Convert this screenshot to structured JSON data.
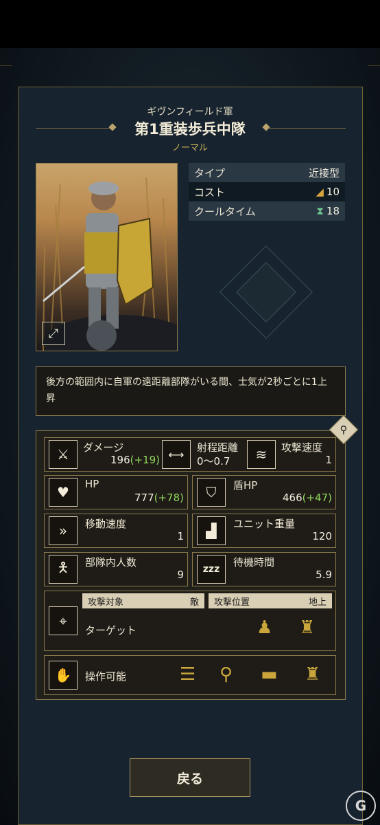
{
  "header": {
    "faction": "ギヴンフィールド軍",
    "unit_name": "第1重装歩兵中隊",
    "rarity": "ノーマル"
  },
  "info": [
    {
      "label": "タイプ",
      "value": "近接型",
      "icon": ""
    },
    {
      "label": "コスト",
      "value": "10",
      "icon": "bread-icon"
    },
    {
      "label": "クールタイム",
      "value": "18",
      "icon": "hourglass-icon"
    }
  ],
  "description": "後方の範囲内に自軍の遠距離部隊がいる間、士気が2秒ごとに1上昇",
  "stats": {
    "damage": {
      "label": "ダメージ",
      "value": "196",
      "bonus": "(+19)"
    },
    "range": {
      "label": "射程距離",
      "value": "0〜0.7"
    },
    "attack_speed": {
      "label": "攻撃速度",
      "value": "1"
    },
    "hp": {
      "label": "HP",
      "value": "777",
      "bonus": "(+78)"
    },
    "shield_hp": {
      "label": "盾HP",
      "value": "466",
      "bonus": "(+47)"
    },
    "move_speed": {
      "label": "移動速度",
      "value": "1"
    },
    "unit_weight": {
      "label": "ユニット重量",
      "value": "120"
    },
    "unit_count": {
      "label": "部隊内人数",
      "value": "9"
    },
    "wait_time": {
      "label": "待機時間",
      "value": "5.9"
    }
  },
  "target": {
    "label": "ターゲット",
    "attack_target_label": "攻撃対象",
    "attack_target_value": "敵",
    "attack_position_label": "攻撃位置",
    "attack_position_value": "地上"
  },
  "operable": {
    "label": "操作可能",
    "icons": [
      "ladder-icon",
      "catapult-icon",
      "cannon-icon",
      "siege-tower-icon"
    ]
  },
  "back_button": "戻る",
  "watermark": "G",
  "colors": {
    "accent_gold": "#c9a53c",
    "bonus_green": "#8fd65a",
    "panel": "#17232e"
  }
}
